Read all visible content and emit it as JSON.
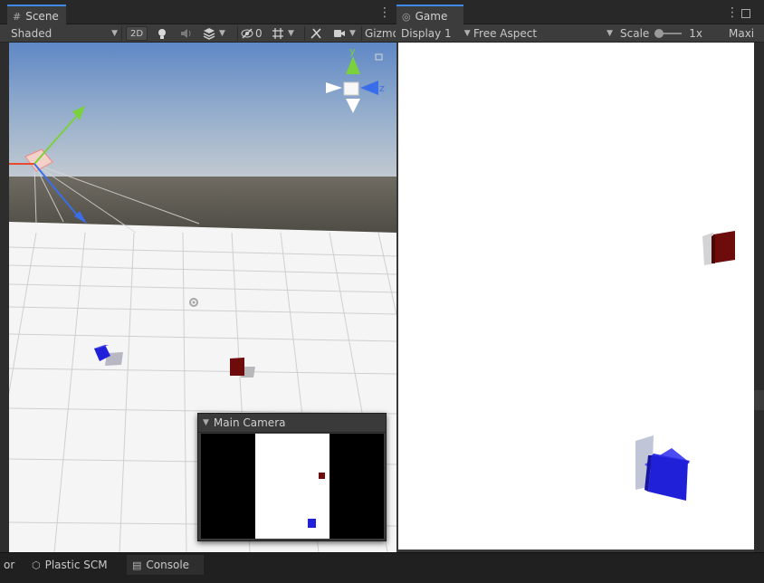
{
  "scene": {
    "tab_label": "Scene",
    "tab_icon": "grid-icon",
    "toolbar": {
      "shading_mode": "Shaded",
      "toggle_2d": "2D",
      "effects_count": "0",
      "gizmos_label": "Gizmos"
    },
    "gizmo": {
      "y_axis": "y",
      "z_axis": "z"
    },
    "camera_overlay": {
      "title": "Main Camera"
    }
  },
  "game": {
    "tab_label": "Game",
    "tab_icon": "gamepad-icon",
    "toolbar": {
      "display": "Display 1",
      "aspect": "Free Aspect",
      "scale_label": "Scale",
      "scale_value": "1x",
      "maximize_label": "Maxi"
    }
  },
  "bottom_bar": {
    "cut_tab": "or",
    "plastic_scm": "Plastic SCM",
    "console": "Console"
  },
  "colors": {
    "red_cube": "#6e0b0b",
    "blue_cube": "#2020d8",
    "x_axis": "#e84a32",
    "y_axis": "#7ad13c",
    "z_axis": "#3a6ee8",
    "accent": "#3d8ae8"
  }
}
